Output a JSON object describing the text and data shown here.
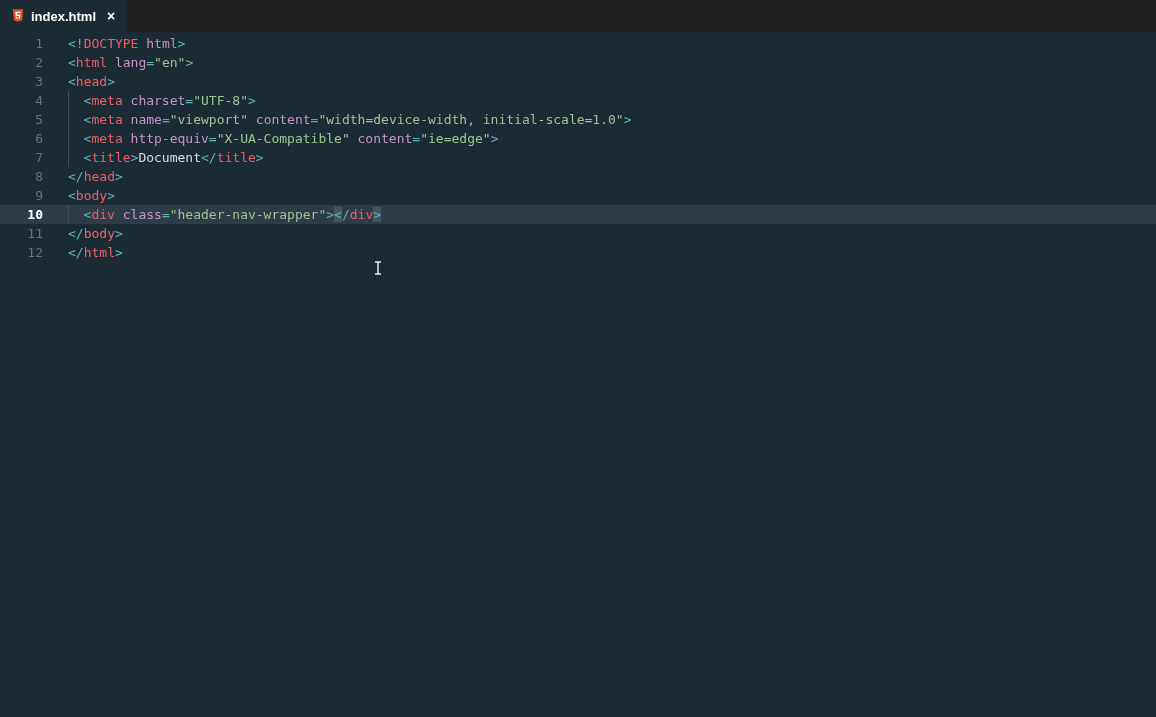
{
  "tab": {
    "label": "index.html",
    "close": "×",
    "selected": true
  },
  "lines": [
    {
      "number": "1",
      "current": false,
      "tokens": [
        {
          "kind": "punct",
          "text": "<!"
        },
        {
          "kind": "tag",
          "text": "DOCTYPE"
        },
        {
          "kind": "attr",
          "text": " html"
        },
        {
          "kind": "punct",
          "text": ">"
        }
      ]
    },
    {
      "number": "2",
      "current": false,
      "tokens": [
        {
          "kind": "punct",
          "text": "<"
        },
        {
          "kind": "tag",
          "text": "html"
        },
        {
          "kind": "attr",
          "text": " lang"
        },
        {
          "kind": "punct",
          "text": "="
        },
        {
          "kind": "string",
          "text": "\"en\""
        },
        {
          "kind": "punct",
          "text": ">"
        }
      ]
    },
    {
      "number": "3",
      "current": false,
      "tokens": [
        {
          "kind": "punct",
          "text": "<"
        },
        {
          "kind": "tag",
          "text": "head"
        },
        {
          "kind": "punct",
          "text": ">"
        }
      ],
      "children": [
        {
          "number": "4",
          "current": false,
          "tokens": [
            {
              "kind": "punct",
              "text": "<"
            },
            {
              "kind": "tag",
              "text": "meta"
            },
            {
              "kind": "attr",
              "text": " charset"
            },
            {
              "kind": "punct",
              "text": "="
            },
            {
              "kind": "string",
              "text": "\"UTF-8\""
            },
            {
              "kind": "punct",
              "text": ">"
            }
          ]
        },
        {
          "number": "5",
          "current": false,
          "tokens": [
            {
              "kind": "punct",
              "text": "<"
            },
            {
              "kind": "tag",
              "text": "meta"
            },
            {
              "kind": "attr",
              "text": " name"
            },
            {
              "kind": "punct",
              "text": "="
            },
            {
              "kind": "string",
              "text": "\"viewport\""
            },
            {
              "kind": "attr",
              "text": " content"
            },
            {
              "kind": "punct",
              "text": "="
            },
            {
              "kind": "string",
              "text": "\"width=device-width, initial-scale=1.0\""
            },
            {
              "kind": "punct",
              "text": ">"
            }
          ]
        },
        {
          "number": "6",
          "current": false,
          "tokens": [
            {
              "kind": "punct",
              "text": "<"
            },
            {
              "kind": "tag",
              "text": "meta"
            },
            {
              "kind": "attr",
              "text": " http-equiv"
            },
            {
              "kind": "punct",
              "text": "="
            },
            {
              "kind": "string",
              "text": "\"X-UA-Compatible\""
            },
            {
              "kind": "attr",
              "text": " content"
            },
            {
              "kind": "punct",
              "text": "="
            },
            {
              "kind": "string",
              "text": "\"ie=edge\""
            },
            {
              "kind": "punct",
              "text": ">"
            }
          ]
        },
        {
          "number": "7",
          "current": false,
          "tokens": [
            {
              "kind": "punct",
              "text": "<"
            },
            {
              "kind": "tag",
              "text": "title"
            },
            {
              "kind": "punct",
              "text": ">"
            },
            {
              "kind": "text",
              "text": "Document"
            },
            {
              "kind": "punct",
              "text": "</"
            },
            {
              "kind": "tag",
              "text": "title"
            },
            {
              "kind": "punct",
              "text": ">"
            }
          ]
        }
      ]
    },
    {
      "number": "8",
      "current": false,
      "tokens": [
        {
          "kind": "punct",
          "text": "</"
        },
        {
          "kind": "tag",
          "text": "head"
        },
        {
          "kind": "punct",
          "text": ">"
        }
      ]
    },
    {
      "number": "9",
      "current": false,
      "tokens": [
        {
          "kind": "punct",
          "text": "<"
        },
        {
          "kind": "tag",
          "text": "body"
        },
        {
          "kind": "punct",
          "text": ">"
        }
      ],
      "children": [
        {
          "number": "10",
          "current": true,
          "tokens": [
            {
              "kind": "punct",
              "text": "<"
            },
            {
              "kind": "tag",
              "text": "div"
            },
            {
              "kind": "attr",
              "text": " class"
            },
            {
              "kind": "punct",
              "text": "="
            },
            {
              "kind": "string",
              "text": "\"header-nav-wrapper\""
            },
            {
              "kind": "punct",
              "text": ">"
            },
            {
              "kind": "match",
              "text": "<"
            },
            {
              "kind": "punct",
              "text": "/"
            },
            {
              "kind": "tag",
              "text": "div"
            },
            {
              "kind": "match",
              "text": ">"
            }
          ]
        }
      ]
    },
    {
      "number": "11",
      "current": false,
      "tokens": [
        {
          "kind": "punct",
          "text": "</"
        },
        {
          "kind": "tag",
          "text": "body"
        },
        {
          "kind": "punct",
          "text": ">"
        }
      ]
    },
    {
      "number": "12",
      "current": false,
      "tokens": [
        {
          "kind": "punct",
          "text": "</"
        },
        {
          "kind": "tag",
          "text": "html"
        },
        {
          "kind": "punct",
          "text": ">"
        }
      ]
    }
  ]
}
